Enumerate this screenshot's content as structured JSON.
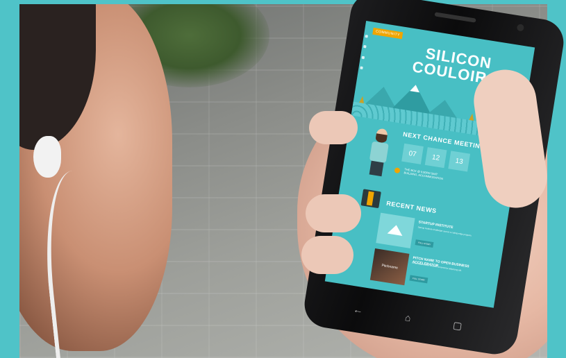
{
  "app": {
    "logo_line1": "SILICON",
    "logo_line2": "COULOIR",
    "menu_badge": "COMMUNITY"
  },
  "meeting": {
    "title": "NEXT CHANCE MEETING",
    "dates": [
      "07",
      "12",
      "13"
    ],
    "location": "THE BOX @ 5:00PM SMIT BUILDING, ACCOMMODATION"
  },
  "news": {
    "title": "RECENT NEWS",
    "items": [
      {
        "title": "STARTUP INSTITUTE",
        "desc": "Startup Institute Challenger across a cutting-edge program.",
        "button": "FULL STORY"
      },
      {
        "title": "PITCH NAME TO OPEN BUSINESS ACCELERATOR",
        "desc": "Lorem ipsum dolor sit amet consectetur adipiscing elit.",
        "button": "FULL STORY",
        "thumb_text": "Pitchname"
      }
    ]
  },
  "colors": {
    "brand_teal": "#48bfc4",
    "accent_orange": "#f0a500",
    "frame_teal": "#4fc3c8"
  },
  "icons": {
    "nav_back": "back-icon",
    "nav_home": "home-icon",
    "nav_recent": "recent-apps-icon"
  }
}
